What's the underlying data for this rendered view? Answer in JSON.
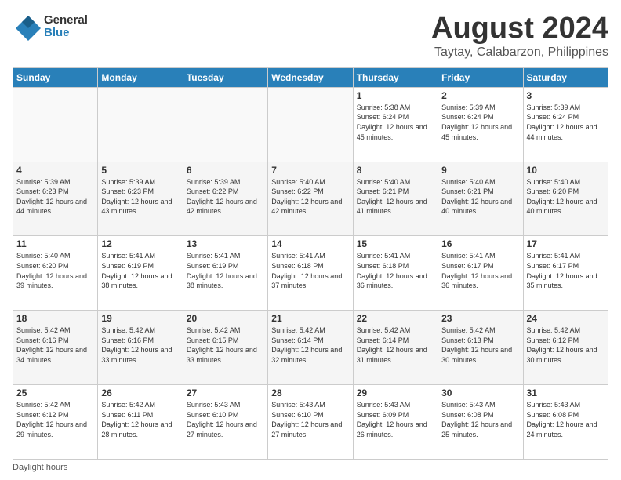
{
  "logo": {
    "general": "General",
    "blue": "Blue"
  },
  "title": "August 2024",
  "subtitle": "Taytay, Calabarzon, Philippines",
  "days_of_week": [
    "Sunday",
    "Monday",
    "Tuesday",
    "Wednesday",
    "Thursday",
    "Friday",
    "Saturday"
  ],
  "footer": "Daylight hours",
  "weeks": [
    [
      {
        "day": "",
        "sunrise": "",
        "sunset": "",
        "daylight": ""
      },
      {
        "day": "",
        "sunrise": "",
        "sunset": "",
        "daylight": ""
      },
      {
        "day": "",
        "sunrise": "",
        "sunset": "",
        "daylight": ""
      },
      {
        "day": "",
        "sunrise": "",
        "sunset": "",
        "daylight": ""
      },
      {
        "day": "1",
        "sunrise": "Sunrise: 5:38 AM",
        "sunset": "Sunset: 6:24 PM",
        "daylight": "Daylight: 12 hours and 45 minutes."
      },
      {
        "day": "2",
        "sunrise": "Sunrise: 5:39 AM",
        "sunset": "Sunset: 6:24 PM",
        "daylight": "Daylight: 12 hours and 45 minutes."
      },
      {
        "day": "3",
        "sunrise": "Sunrise: 5:39 AM",
        "sunset": "Sunset: 6:24 PM",
        "daylight": "Daylight: 12 hours and 44 minutes."
      }
    ],
    [
      {
        "day": "4",
        "sunrise": "Sunrise: 5:39 AM",
        "sunset": "Sunset: 6:23 PM",
        "daylight": "Daylight: 12 hours and 44 minutes."
      },
      {
        "day": "5",
        "sunrise": "Sunrise: 5:39 AM",
        "sunset": "Sunset: 6:23 PM",
        "daylight": "Daylight: 12 hours and 43 minutes."
      },
      {
        "day": "6",
        "sunrise": "Sunrise: 5:39 AM",
        "sunset": "Sunset: 6:22 PM",
        "daylight": "Daylight: 12 hours and 42 minutes."
      },
      {
        "day": "7",
        "sunrise": "Sunrise: 5:40 AM",
        "sunset": "Sunset: 6:22 PM",
        "daylight": "Daylight: 12 hours and 42 minutes."
      },
      {
        "day": "8",
        "sunrise": "Sunrise: 5:40 AM",
        "sunset": "Sunset: 6:21 PM",
        "daylight": "Daylight: 12 hours and 41 minutes."
      },
      {
        "day": "9",
        "sunrise": "Sunrise: 5:40 AM",
        "sunset": "Sunset: 6:21 PM",
        "daylight": "Daylight: 12 hours and 40 minutes."
      },
      {
        "day": "10",
        "sunrise": "Sunrise: 5:40 AM",
        "sunset": "Sunset: 6:20 PM",
        "daylight": "Daylight: 12 hours and 40 minutes."
      }
    ],
    [
      {
        "day": "11",
        "sunrise": "Sunrise: 5:40 AM",
        "sunset": "Sunset: 6:20 PM",
        "daylight": "Daylight: 12 hours and 39 minutes."
      },
      {
        "day": "12",
        "sunrise": "Sunrise: 5:41 AM",
        "sunset": "Sunset: 6:19 PM",
        "daylight": "Daylight: 12 hours and 38 minutes."
      },
      {
        "day": "13",
        "sunrise": "Sunrise: 5:41 AM",
        "sunset": "Sunset: 6:19 PM",
        "daylight": "Daylight: 12 hours and 38 minutes."
      },
      {
        "day": "14",
        "sunrise": "Sunrise: 5:41 AM",
        "sunset": "Sunset: 6:18 PM",
        "daylight": "Daylight: 12 hours and 37 minutes."
      },
      {
        "day": "15",
        "sunrise": "Sunrise: 5:41 AM",
        "sunset": "Sunset: 6:18 PM",
        "daylight": "Daylight: 12 hours and 36 minutes."
      },
      {
        "day": "16",
        "sunrise": "Sunrise: 5:41 AM",
        "sunset": "Sunset: 6:17 PM",
        "daylight": "Daylight: 12 hours and 36 minutes."
      },
      {
        "day": "17",
        "sunrise": "Sunrise: 5:41 AM",
        "sunset": "Sunset: 6:17 PM",
        "daylight": "Daylight: 12 hours and 35 minutes."
      }
    ],
    [
      {
        "day": "18",
        "sunrise": "Sunrise: 5:42 AM",
        "sunset": "Sunset: 6:16 PM",
        "daylight": "Daylight: 12 hours and 34 minutes."
      },
      {
        "day": "19",
        "sunrise": "Sunrise: 5:42 AM",
        "sunset": "Sunset: 6:16 PM",
        "daylight": "Daylight: 12 hours and 33 minutes."
      },
      {
        "day": "20",
        "sunrise": "Sunrise: 5:42 AM",
        "sunset": "Sunset: 6:15 PM",
        "daylight": "Daylight: 12 hours and 33 minutes."
      },
      {
        "day": "21",
        "sunrise": "Sunrise: 5:42 AM",
        "sunset": "Sunset: 6:14 PM",
        "daylight": "Daylight: 12 hours and 32 minutes."
      },
      {
        "day": "22",
        "sunrise": "Sunrise: 5:42 AM",
        "sunset": "Sunset: 6:14 PM",
        "daylight": "Daylight: 12 hours and 31 minutes."
      },
      {
        "day": "23",
        "sunrise": "Sunrise: 5:42 AM",
        "sunset": "Sunset: 6:13 PM",
        "daylight": "Daylight: 12 hours and 30 minutes."
      },
      {
        "day": "24",
        "sunrise": "Sunrise: 5:42 AM",
        "sunset": "Sunset: 6:12 PM",
        "daylight": "Daylight: 12 hours and 30 minutes."
      }
    ],
    [
      {
        "day": "25",
        "sunrise": "Sunrise: 5:42 AM",
        "sunset": "Sunset: 6:12 PM",
        "daylight": "Daylight: 12 hours and 29 minutes."
      },
      {
        "day": "26",
        "sunrise": "Sunrise: 5:42 AM",
        "sunset": "Sunset: 6:11 PM",
        "daylight": "Daylight: 12 hours and 28 minutes."
      },
      {
        "day": "27",
        "sunrise": "Sunrise: 5:43 AM",
        "sunset": "Sunset: 6:10 PM",
        "daylight": "Daylight: 12 hours and 27 minutes."
      },
      {
        "day": "28",
        "sunrise": "Sunrise: 5:43 AM",
        "sunset": "Sunset: 6:10 PM",
        "daylight": "Daylight: 12 hours and 27 minutes."
      },
      {
        "day": "29",
        "sunrise": "Sunrise: 5:43 AM",
        "sunset": "Sunset: 6:09 PM",
        "daylight": "Daylight: 12 hours and 26 minutes."
      },
      {
        "day": "30",
        "sunrise": "Sunrise: 5:43 AM",
        "sunset": "Sunset: 6:08 PM",
        "daylight": "Daylight: 12 hours and 25 minutes."
      },
      {
        "day": "31",
        "sunrise": "Sunrise: 5:43 AM",
        "sunset": "Sunset: 6:08 PM",
        "daylight": "Daylight: 12 hours and 24 minutes."
      }
    ]
  ]
}
